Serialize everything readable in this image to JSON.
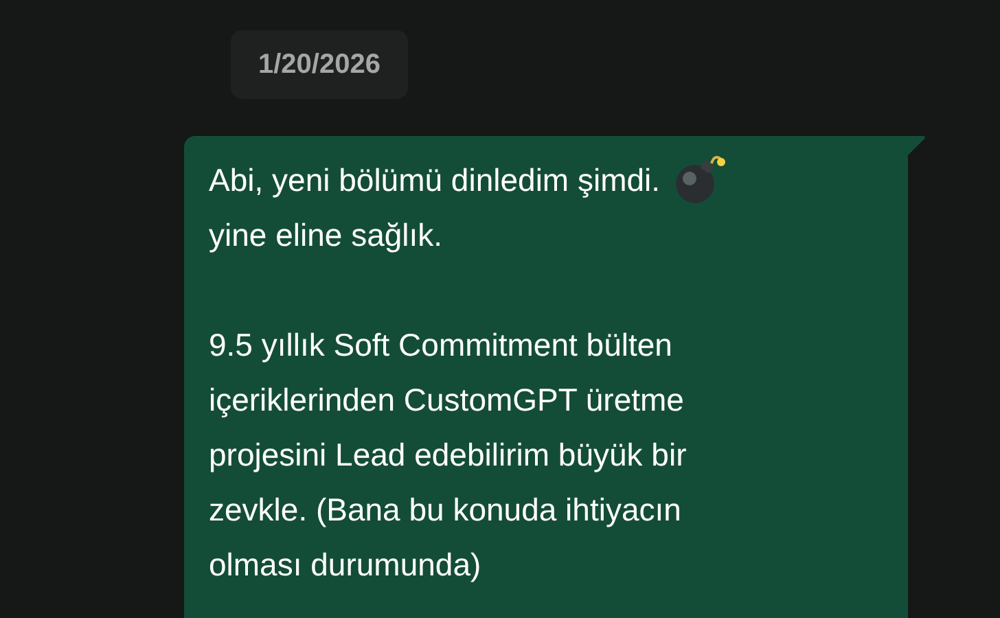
{
  "date_chip": "1/20/2026",
  "message": {
    "paragraphs": [
      [
        "Abi, yeni bölümü dinledim şimdi.",
        "yine eline sağlık."
      ],
      [
        "9.5 yıllık Soft Commitment bülten",
        "içeriklerinden CustomGPT üretme",
        "projesini Lead edebilirim büyük bir",
        "zevkle. (Bana bu konuda ihtiyacın",
        "olması durumunda)"
      ]
    ]
  }
}
